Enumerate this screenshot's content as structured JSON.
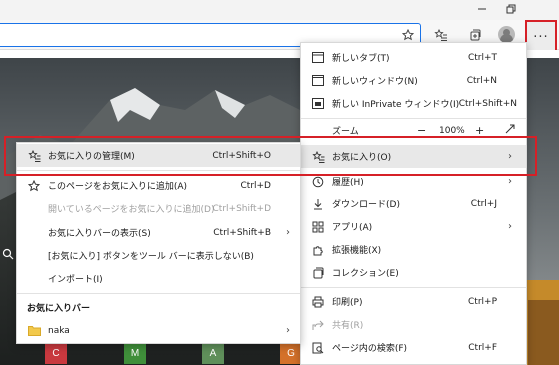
{
  "window": {
    "minimize_icon": "minimize-icon",
    "restore_icon": "restore-icon"
  },
  "toolbar": {
    "more_button_label": "···"
  },
  "main_menu": {
    "items": [
      {
        "label": "新しいタブ(T)",
        "shortcut": "Ctrl+T"
      },
      {
        "label": "新しいウィンドウ(N)",
        "shortcut": "Ctrl+N"
      },
      {
        "label": "新しい InPrivate ウィンドウ(I)",
        "shortcut": "Ctrl+Shift+N"
      },
      {
        "label": "ズーム",
        "zoom_minus": "−",
        "zoom_value": "100%",
        "zoom_plus": "+"
      },
      {
        "label": "お気に入り(O)"
      },
      {
        "label": "履歴(H)"
      },
      {
        "label": "ダウンロード(D)",
        "shortcut": "Ctrl+J"
      },
      {
        "label": "アプリ(A)"
      },
      {
        "label": "拡張機能(X)"
      },
      {
        "label": "コレクション(E)"
      },
      {
        "label": "印刷(P)",
        "shortcut": "Ctrl+P"
      },
      {
        "label": "共有(R)"
      },
      {
        "label": "ページ内の検索(F)",
        "shortcut": "Ctrl+F"
      }
    ]
  },
  "favorites_menu": {
    "items": [
      {
        "label": "お気に入りの管理(M)",
        "shortcut": "Ctrl+Shift+O"
      },
      {
        "label": "このページをお気に入りに追加(A)",
        "shortcut": "Ctrl+D"
      },
      {
        "label": "開いているページをお気に入りに追加(D)",
        "shortcut": "Ctrl+Shift+D"
      },
      {
        "label": "お気に入りバーの表示(S)",
        "shortcut": "Ctrl+Shift+B"
      },
      {
        "label": "[お気に入り] ボタンをツール バーに表示しない(B)"
      },
      {
        "label": "インポート(I)"
      }
    ],
    "section_header": "お気に入りバー",
    "folder": {
      "label": "naka"
    }
  },
  "ntp_tiles": [
    {
      "letter": "C",
      "color": "#c9393f"
    },
    {
      "letter": "M",
      "color": "#3f8f3a"
    },
    {
      "letter": "A",
      "color": "#5f8f5a"
    },
    {
      "letter": "G",
      "color": "#d4712a"
    }
  ]
}
